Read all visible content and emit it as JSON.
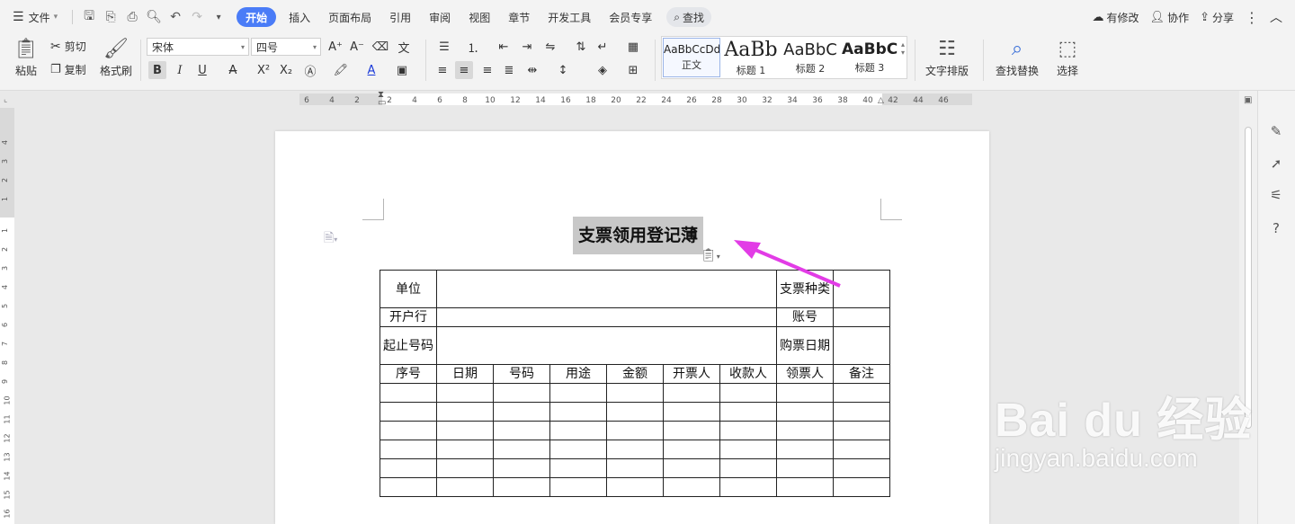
{
  "menubar": {
    "file_label": "文件",
    "tabs": [
      "开始",
      "插入",
      "页面布局",
      "引用",
      "审阅",
      "视图",
      "章节",
      "开发工具",
      "会员专享"
    ],
    "search_label": "查找",
    "right": {
      "changes": "有修改",
      "collab": "协作",
      "share": "分享"
    }
  },
  "ribbon": {
    "paste": "粘贴",
    "cut": "剪切",
    "copy": "复制",
    "format_painter": "格式刷",
    "font_name": "宋体",
    "font_size": "四号",
    "styles": [
      {
        "preview": "AaBbCcDd",
        "name": "正文"
      },
      {
        "preview": "AaBb",
        "name": "标题 1"
      },
      {
        "preview": "AaBbC",
        "name": "标题 2"
      },
      {
        "preview": "AaBbC",
        "name": "标题 3"
      }
    ],
    "text_layout": "文字排版",
    "find_replace": "查找替换",
    "select": "选择"
  },
  "ruler": {
    "h_ticks": [
      "6",
      "4",
      "2",
      "2",
      "4",
      "6",
      "8",
      "10",
      "12",
      "14",
      "16",
      "18",
      "20",
      "22",
      "24",
      "26",
      "28",
      "30",
      "32",
      "34",
      "36",
      "38",
      "40",
      "42",
      "44",
      "46"
    ],
    "v_ticks": [
      "4",
      "3",
      "2",
      "1",
      "1",
      "2",
      "3",
      "4",
      "5",
      "6",
      "7",
      "8",
      "9",
      "10",
      "11",
      "12",
      "13",
      "14",
      "15",
      "16"
    ]
  },
  "document": {
    "title": "支票领用登记薄",
    "table": {
      "r1": {
        "unit": "单位",
        "cheque_type": "支票种类"
      },
      "r2": {
        "bank": "开户行",
        "account": "账号"
      },
      "r3": {
        "number_range": "起止号码",
        "purchase_date": "购票日期"
      },
      "headers": [
        "序号",
        "日期",
        "号码",
        "用途",
        "金额",
        "开票人",
        "收款人",
        "领票人",
        "备注"
      ]
    }
  },
  "watermark": {
    "logo": "Bai du 经验",
    "sub": "jingyan.baidu.com"
  }
}
